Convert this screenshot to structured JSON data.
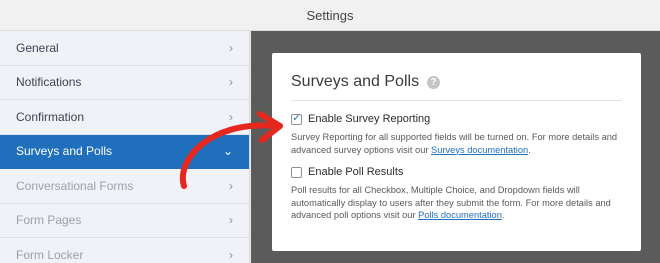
{
  "topbar": {
    "title": "Settings"
  },
  "sidebar": {
    "items": [
      {
        "label": "General",
        "state": "normal"
      },
      {
        "label": "Notifications",
        "state": "normal"
      },
      {
        "label": "Confirmation",
        "state": "normal"
      },
      {
        "label": "Surveys and Polls",
        "state": "active"
      },
      {
        "label": "Conversational Forms",
        "state": "disabled"
      },
      {
        "label": "Form Pages",
        "state": "disabled"
      },
      {
        "label": "Form Locker",
        "state": "disabled"
      }
    ]
  },
  "panel": {
    "title": "Surveys and Polls",
    "help_icon": "question-mark",
    "survey": {
      "label": "Enable Survey Reporting",
      "checked": true,
      "desc_before": "Survey Reporting for all supported fields will be turned on. For more details and advanced survey options visit our ",
      "link": "Surveys documentation",
      "desc_after": "."
    },
    "poll": {
      "label": "Enable Poll Results",
      "checked": false,
      "desc_before": "Poll results for all Checkbox, Multiple Choice, and Dropdown fields will automatically display to users after they submit the form. For more details and advanced poll options visit our ",
      "link": "Polls documentation",
      "desc_after": "."
    }
  },
  "colors": {
    "accent": "#1f6fbd",
    "arrow": "#e5281e"
  }
}
